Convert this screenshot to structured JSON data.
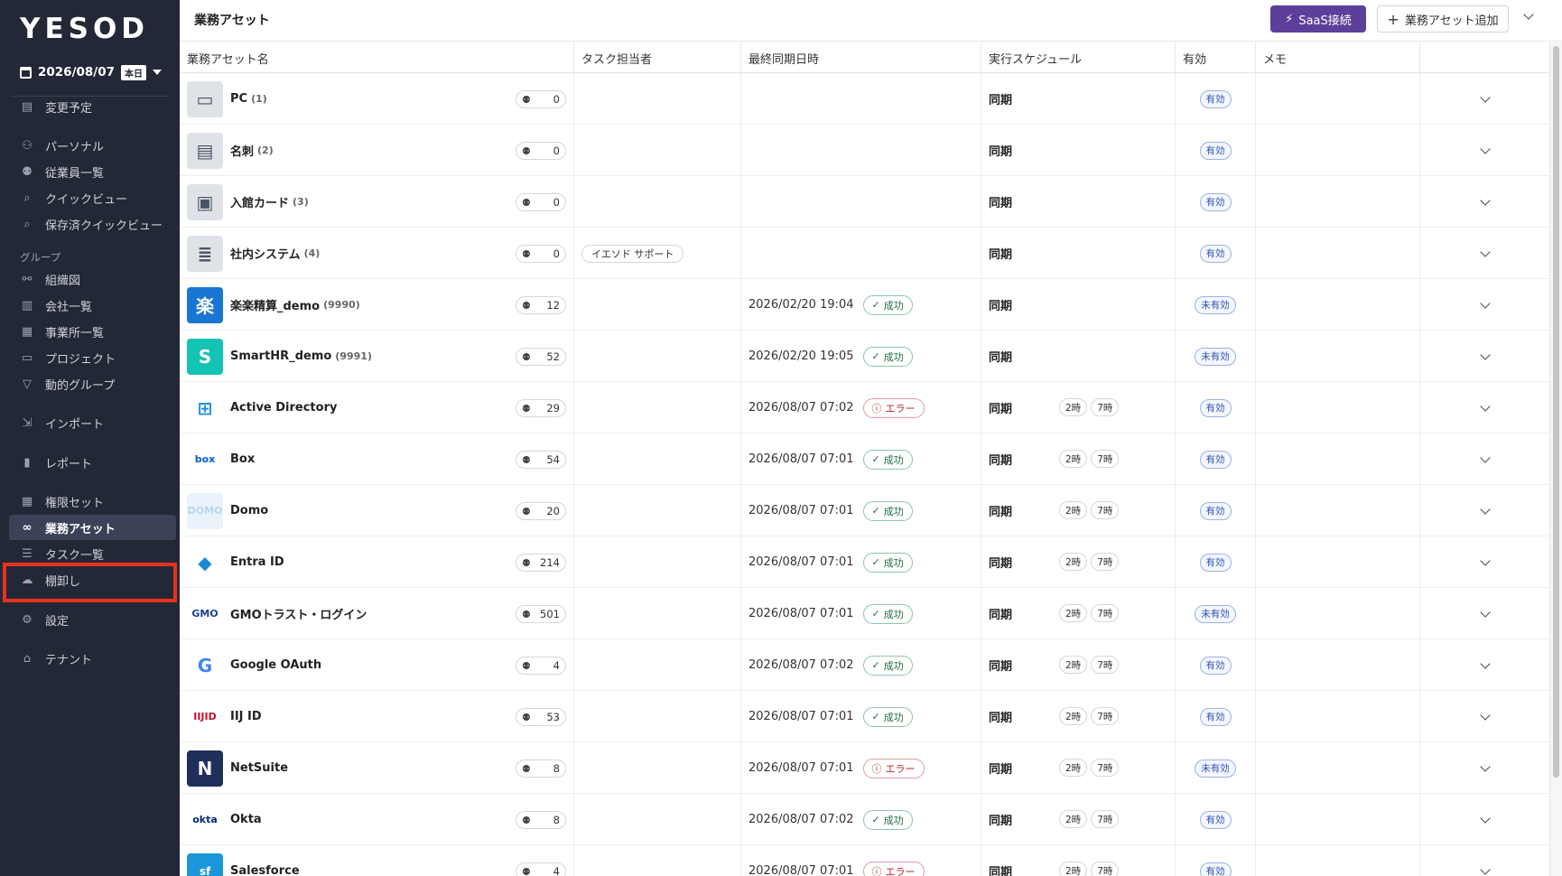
{
  "sidebar": {
    "logo": "YESOD",
    "date": "2026/08/07",
    "today_label": "本日",
    "items": [
      {
        "label": "変更予定",
        "icon": "document-icon"
      },
      {
        "label": "パーソナル",
        "icon": "person-icon"
      },
      {
        "label": "従業員一覧",
        "icon": "people-icon"
      },
      {
        "label": "クイックビュー",
        "icon": "search-icon"
      },
      {
        "label": "保存済クイックビュー",
        "icon": "search-icon"
      },
      {
        "label": "組織図",
        "icon": "org-chart-icon"
      },
      {
        "label": "会社一覧",
        "icon": "building-icon"
      },
      {
        "label": "事業所一覧",
        "icon": "office-icon"
      },
      {
        "label": "プロジェクト",
        "icon": "briefcase-icon"
      },
      {
        "label": "動的グループ",
        "icon": "filter-icon"
      },
      {
        "label": "インポート",
        "icon": "import-icon"
      },
      {
        "label": "レポート",
        "icon": "bar-chart-icon"
      },
      {
        "label": "権限セット",
        "icon": "grid-icon"
      },
      {
        "label": "業務アセット",
        "icon": "link-icon"
      },
      {
        "label": "タスク一覧",
        "icon": "list-icon"
      },
      {
        "label": "棚卸し",
        "icon": "cloud-icon"
      },
      {
        "label": "設定",
        "icon": "gear-icon"
      },
      {
        "label": "テナント",
        "icon": "tenant-icon"
      }
    ],
    "section_group": "グループ"
  },
  "header": {
    "title": "業務アセット",
    "saas_button": "SaaS接続",
    "add_button": "業務アセット追加"
  },
  "table": {
    "columns": [
      "業務アセット名",
      "タスク担当者",
      "最終同期日時",
      "実行スケジュール",
      "有効",
      "メモ"
    ],
    "rows": [
      {
        "name": "PC",
        "count": "(1)",
        "users": "0",
        "assignee": "",
        "synced": "",
        "status": "",
        "schedule": "同期",
        "times": [],
        "valid": "有効",
        "icon_text": "▭",
        "icon_bg": "#dfe3e8",
        "icon_fg": "#4a5563"
      },
      {
        "name": "名刺",
        "count": "(2)",
        "users": "0",
        "assignee": "",
        "synced": "",
        "status": "",
        "schedule": "同期",
        "times": [],
        "valid": "有効",
        "icon_text": "▤",
        "icon_bg": "#dfe3e8",
        "icon_fg": "#4a5563"
      },
      {
        "name": "入館カード",
        "count": "(3)",
        "users": "0",
        "assignee": "",
        "synced": "",
        "status": "",
        "schedule": "同期",
        "times": [],
        "valid": "有効",
        "icon_text": "▣",
        "icon_bg": "#dfe3e8",
        "icon_fg": "#4a5563"
      },
      {
        "name": "社内システム",
        "count": "(4)",
        "users": "0",
        "assignee": "イエソド サポート",
        "synced": "",
        "status": "",
        "schedule": "同期",
        "times": [],
        "valid": "有効",
        "icon_text": "≣",
        "icon_bg": "#dfe3e8",
        "icon_fg": "#4a5563"
      },
      {
        "name": "楽楽精算_demo",
        "count": "(9990)",
        "users": "12",
        "assignee": "",
        "synced": "2026/02/20 19:04",
        "status": "成功",
        "schedule": "同期",
        "times": [],
        "valid": "未有効",
        "icon_text": "楽",
        "icon_bg": "#1976d2",
        "icon_fg": "#ffffff"
      },
      {
        "name": "SmartHR_demo",
        "count": "(9991)",
        "users": "52",
        "assignee": "",
        "synced": "2026/02/20 19:05",
        "status": "成功",
        "schedule": "同期",
        "times": [],
        "valid": "未有効",
        "icon_text": "S",
        "icon_bg": "#15c3b5",
        "icon_fg": "#ffffff"
      },
      {
        "name": "Active Directory",
        "count": "",
        "users": "29",
        "assignee": "",
        "synced": "2026/08/07 07:02",
        "status": "エラー",
        "schedule": "同期",
        "times": [
          "2時",
          "7時"
        ],
        "valid": "有効",
        "icon_text": "⊞",
        "icon_bg": "#ffffff",
        "icon_fg": "#1e90e0"
      },
      {
        "name": "Box",
        "count": "",
        "users": "54",
        "assignee": "",
        "synced": "2026/08/07 07:01",
        "status": "成功",
        "schedule": "同期",
        "times": [
          "2時",
          "7時"
        ],
        "valid": "有効",
        "icon_text": "box",
        "icon_bg": "#ffffff",
        "icon_fg": "#0061d5"
      },
      {
        "name": "Domo",
        "count": "",
        "users": "20",
        "assignee": "",
        "synced": "2026/08/07 07:01",
        "status": "成功",
        "schedule": "同期",
        "times": [
          "2時",
          "7時"
        ],
        "valid": "有効",
        "icon_text": "DOMO",
        "icon_bg": "#eaf3fb",
        "icon_fg": "#b9d6ee"
      },
      {
        "name": "Entra ID",
        "count": "",
        "users": "214",
        "assignee": "",
        "synced": "2026/08/07 07:01",
        "status": "成功",
        "schedule": "同期",
        "times": [
          "2時",
          "7時"
        ],
        "valid": "有効",
        "icon_text": "◆",
        "icon_bg": "#ffffff",
        "icon_fg": "#1a8ad6"
      },
      {
        "name": "GMOトラスト・ログイン",
        "count": "",
        "users": "501",
        "assignee": "",
        "synced": "2026/08/07 07:01",
        "status": "成功",
        "schedule": "同期",
        "times": [
          "2時",
          "7時"
        ],
        "valid": "未有効",
        "icon_text": "GMO",
        "icon_bg": "#ffffff",
        "icon_fg": "#1d3f8f"
      },
      {
        "name": "Google OAuth",
        "count": "",
        "users": "4",
        "assignee": "",
        "synced": "2026/08/07 07:02",
        "status": "成功",
        "schedule": "同期",
        "times": [
          "2時",
          "7時"
        ],
        "valid": "有効",
        "icon_text": "G",
        "icon_bg": "#ffffff",
        "icon_fg": "#4285f4"
      },
      {
        "name": "IIJ ID",
        "count": "",
        "users": "53",
        "assignee": "",
        "synced": "2026/08/07 07:01",
        "status": "成功",
        "schedule": "同期",
        "times": [
          "2時",
          "7時"
        ],
        "valid": "有効",
        "icon_text": "IIJID",
        "icon_bg": "#ffffff",
        "icon_fg": "#c8102e"
      },
      {
        "name": "NetSuite",
        "count": "",
        "users": "8",
        "assignee": "",
        "synced": "2026/08/07 07:01",
        "status": "エラー",
        "schedule": "同期",
        "times": [
          "2時",
          "7時"
        ],
        "valid": "未有効",
        "icon_text": "N",
        "icon_bg": "#1f2f5a",
        "icon_fg": "#ffffff"
      },
      {
        "name": "Okta",
        "count": "",
        "users": "8",
        "assignee": "",
        "synced": "2026/08/07 07:02",
        "status": "成功",
        "schedule": "同期",
        "times": [
          "2時",
          "7時"
        ],
        "valid": "有効",
        "icon_text": "okta",
        "icon_bg": "#ffffff",
        "icon_fg": "#00297a"
      },
      {
        "name": "Salesforce",
        "count": "",
        "users": "4",
        "assignee": "",
        "synced": "2026/08/07 07:01",
        "status": "エラー",
        "schedule": "同期",
        "times": [
          "2時",
          "7時"
        ],
        "valid": "有効",
        "icon_text": "sf",
        "icon_bg": "#1b96d8",
        "icon_fg": "#ffffff"
      }
    ]
  },
  "colors": {
    "sidebar_bg": "#232837",
    "accent": "#5d3f9a",
    "highlight": "#e8301c",
    "success": "#1f6e43",
    "error": "#b3262f",
    "valid": "#2d52b0"
  }
}
